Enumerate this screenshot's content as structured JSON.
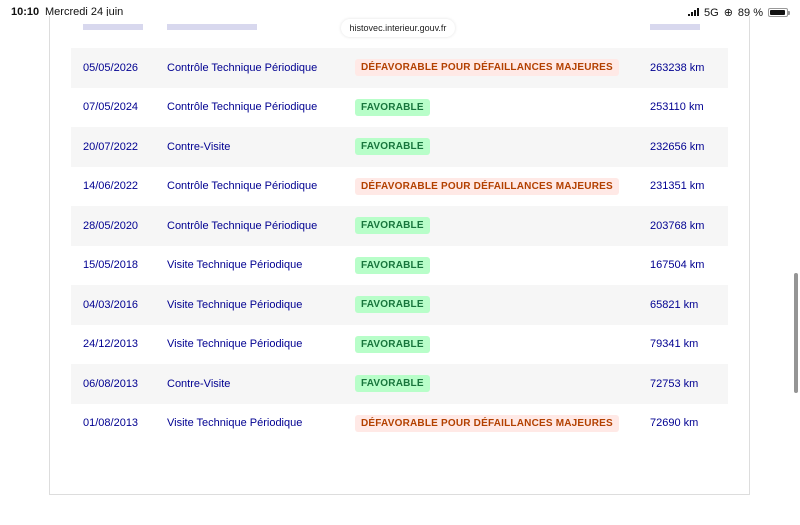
{
  "status_bar": {
    "time": "10:10",
    "date": "Mercredi 24 juin",
    "network": "5G",
    "battery": "89 %"
  },
  "browser": {
    "url": "histovec.interieur.gouv.fr"
  },
  "colors": {
    "text_blue": "#000091",
    "favorable_bg": "#b8fec9",
    "favorable_text": "#18753c",
    "defavorable_bg": "#ffe9e6",
    "defavorable_text": "#b34000"
  },
  "controles": [
    {
      "date": "05/05/2026",
      "type": "Contrôle Technique Périodique",
      "resultat": "DÉFAVORABLE POUR DÉFAILLANCES MAJEURES",
      "status": "defav",
      "km": "263238 km"
    },
    {
      "date": "07/05/2024",
      "type": "Contrôle Technique Périodique",
      "resultat": "FAVORABLE",
      "status": "fav",
      "km": "253110 km"
    },
    {
      "date": "20/07/2022",
      "type": "Contre-Visite",
      "resultat": "FAVORABLE",
      "status": "fav",
      "km": "232656 km"
    },
    {
      "date": "14/06/2022",
      "type": "Contrôle Technique Périodique",
      "resultat": "DÉFAVORABLE POUR DÉFAILLANCES MAJEURES",
      "status": "defav",
      "km": "231351 km"
    },
    {
      "date": "28/05/2020",
      "type": "Contrôle Technique Périodique",
      "resultat": "FAVORABLE",
      "status": "fav",
      "km": "203768 km"
    },
    {
      "date": "15/05/2018",
      "type": "Visite Technique Périodique",
      "resultat": "FAVORABLE",
      "status": "fav",
      "km": "167504 km"
    },
    {
      "date": "04/03/2016",
      "type": "Visite Technique Périodique",
      "resultat": "FAVORABLE",
      "status": "fav",
      "km": "65821 km"
    },
    {
      "date": "24/12/2013",
      "type": "Visite Technique Périodique",
      "resultat": "FAVORABLE",
      "status": "fav",
      "km": "79341 km"
    },
    {
      "date": "06/08/2013",
      "type": "Contre-Visite",
      "resultat": "FAVORABLE",
      "status": "fav",
      "km": "72753 km"
    },
    {
      "date": "01/08/2013",
      "type": "Visite Technique Périodique",
      "resultat": "DÉFAVORABLE POUR DÉFAILLANCES MAJEURES",
      "status": "defav",
      "km": "72690 km"
    }
  ]
}
